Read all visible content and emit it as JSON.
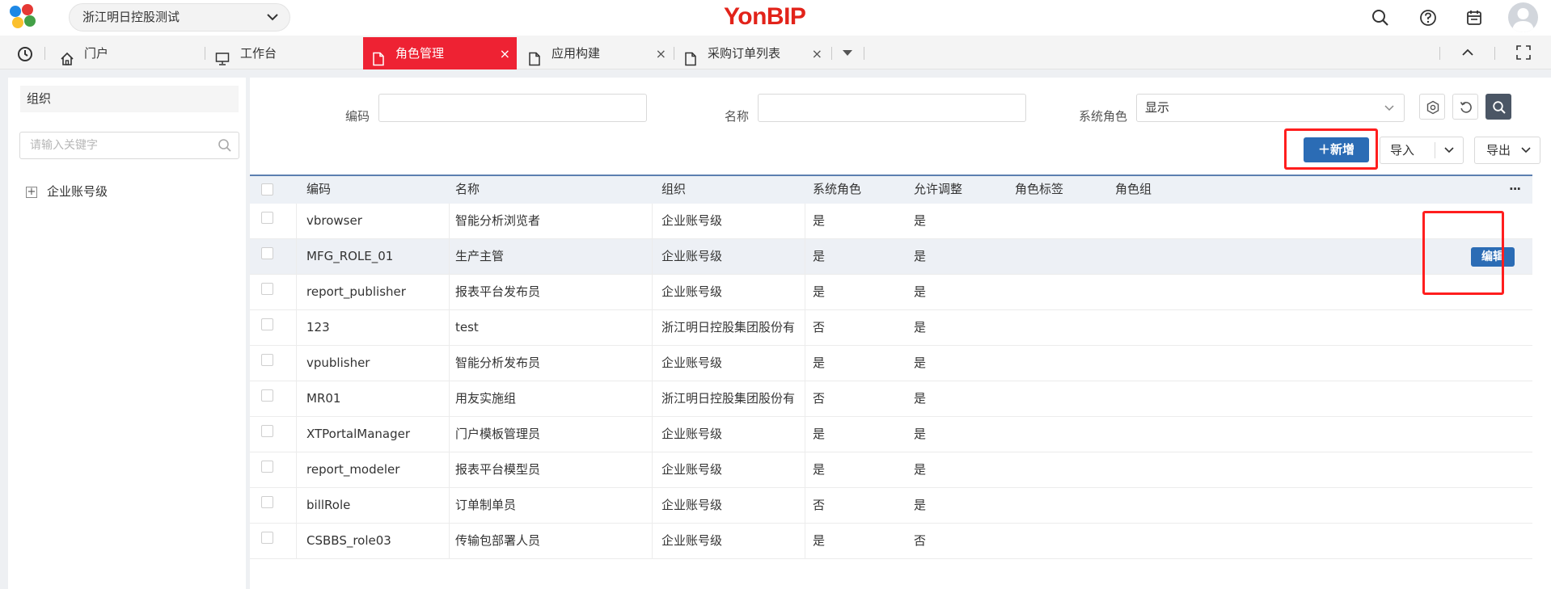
{
  "header": {
    "org_select": "浙江明日控股测试",
    "brand": "YonBIP"
  },
  "tabs": {
    "history_icon": "history-clock-icon",
    "items": [
      {
        "label": "门户",
        "icon": "home-icon",
        "active": false,
        "closable": false
      },
      {
        "label": "工作台",
        "icon": "monitor-icon",
        "active": false,
        "closable": false
      },
      {
        "label": "角色管理",
        "icon": "document-icon",
        "active": true,
        "closable": true
      },
      {
        "label": "应用构建",
        "icon": "document-icon",
        "active": false,
        "closable": true
      },
      {
        "label": "采购订单列表",
        "icon": "document-icon",
        "active": false,
        "closable": true
      }
    ]
  },
  "left": {
    "title": "组织",
    "search_placeholder": "请输入关键字",
    "tree": [
      {
        "label": "企业账号级",
        "expand": "+"
      }
    ]
  },
  "filters": {
    "code_label": "编码",
    "name_label": "名称",
    "sysrole_label": "系统角色",
    "sysrole_value": "显示"
  },
  "actions": {
    "add": "＋新增",
    "import": "导入",
    "export": "导出"
  },
  "table": {
    "columns": [
      "编码",
      "名称",
      "组织",
      "系统角色",
      "允许调整",
      "角色标签",
      "角色组"
    ],
    "more": "···",
    "rows": [
      {
        "code": "vbrowser",
        "name": "智能分析浏览者",
        "org": "企业账号级",
        "sys": "是",
        "adj": "是"
      },
      {
        "code": "MFG_ROLE_01",
        "name": "生产主管",
        "org": "企业账号级",
        "sys": "是",
        "adj": "是",
        "edit": "编辑"
      },
      {
        "code": "report_publisher",
        "name": "报表平台发布员",
        "org": "企业账号级",
        "sys": "是",
        "adj": "是"
      },
      {
        "code": "123",
        "name": "test",
        "org": "浙江明日控股集团股份有",
        "sys": "否",
        "adj": "是"
      },
      {
        "code": "vpublisher",
        "name": "智能分析发布员",
        "org": "企业账号级",
        "sys": "是",
        "adj": "是"
      },
      {
        "code": "MR01",
        "name": "用友实施组",
        "org": "浙江明日控股集团股份有",
        "sys": "否",
        "adj": "是"
      },
      {
        "code": "XTPortalManager",
        "name": "门户模板管理员",
        "org": "企业账号级",
        "sys": "是",
        "adj": "是"
      },
      {
        "code": "report_modeler",
        "name": "报表平台模型员",
        "org": "企业账号级",
        "sys": "是",
        "adj": "是"
      },
      {
        "code": "billRole",
        "name": "订单制单员",
        "org": "企业账号级",
        "sys": "否",
        "adj": "是"
      },
      {
        "code": "CSBBS_role03",
        "name": "传输包部署人员",
        "org": "企业账号级",
        "sys": "是",
        "adj": "否"
      }
    ]
  },
  "colors": {
    "brand_red": "#e2231a",
    "active_tab": "#ee2233",
    "primary_blue": "#2b6cb5",
    "highlight_box": "#ff1e1e"
  }
}
